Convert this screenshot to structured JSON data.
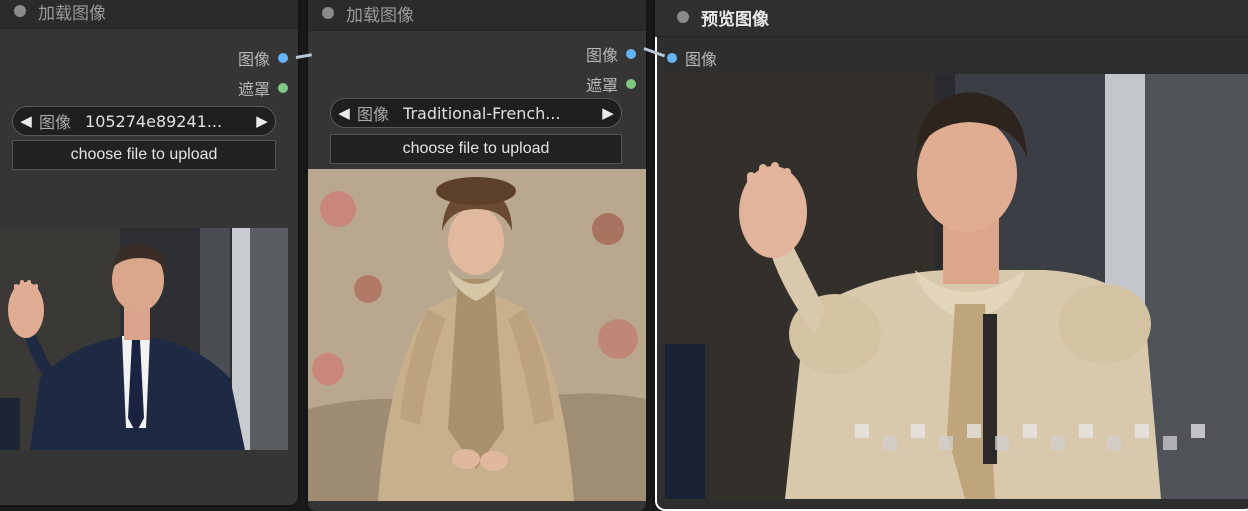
{
  "nodes": {
    "load1": {
      "title": "加载图像",
      "outputs": {
        "image": "图像",
        "mask": "遮罩"
      },
      "combo": {
        "name": "图像",
        "value": "105274e89241...",
        "prev": "◀",
        "next": "▶"
      },
      "upload_label": "choose file to upload"
    },
    "load2": {
      "title": "加载图像",
      "outputs": {
        "image": "图像",
        "mask": "遮罩"
      },
      "combo": {
        "name": "图像",
        "value": "Traditional-French...",
        "prev": "◀",
        "next": "▶"
      },
      "upload_label": "choose file to upload"
    },
    "preview": {
      "title": "预览图像",
      "inputs": {
        "images": "图像"
      }
    }
  },
  "colors": {
    "image_slot": "#64b5f6",
    "mask_slot": "#81c784",
    "node_bg": "#353535",
    "header_bg": "#2b2b2b",
    "selected_outline": "#ffffff"
  },
  "icons": [
    "collapse-dot-icon",
    "arrow-left-icon",
    "arrow-right-icon"
  ]
}
